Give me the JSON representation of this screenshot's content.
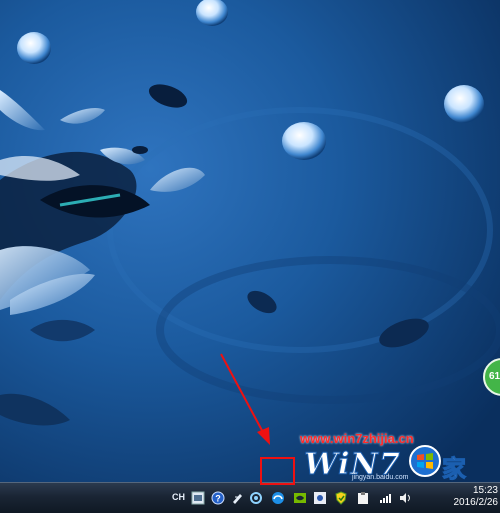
{
  "desktop": {
    "watermark": {
      "url": "www.win7zhijia.cn",
      "logo_text": "WiN7",
      "logo_cn": "家",
      "sub_text": "jingyan.baidu.com"
    },
    "side_badge": "61"
  },
  "taskbar": {
    "language": "CH",
    "tray_icons": [
      "keyboard-icon",
      "help-icon",
      "pen-icon",
      "sync-icon",
      "ie-browser-icon",
      "nvidia-icon",
      "network-app-icon",
      "shield-icon",
      "clipboard-icon",
      "signal-icon",
      "volume-icon"
    ],
    "clock": {
      "time": "15:23",
      "date": "2016/2/26"
    }
  },
  "annotation": {
    "highlight_color": "#ee1111"
  }
}
